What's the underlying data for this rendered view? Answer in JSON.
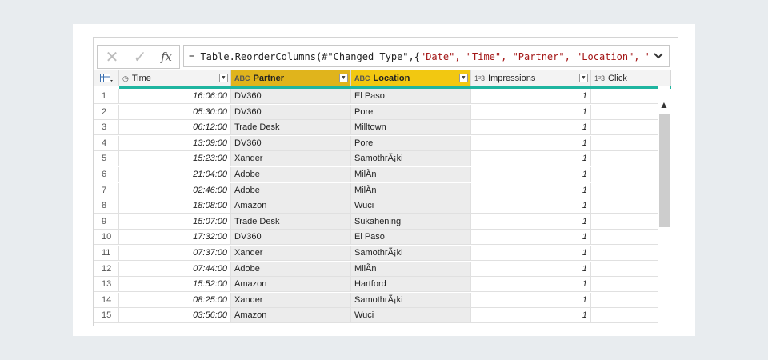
{
  "formula_bar": {
    "cancel_icon": "close-icon",
    "commit_icon": "check-icon",
    "fx_label": "fx",
    "formula_prefix": "= Table.ReorderColumns(#\"Changed Type\",{",
    "formula_strings": "\"Date\", \"Time\", \"Partner\", \"Location\", \"Impressions\",",
    "expand_icon": "chevron-down-icon"
  },
  "columns": [
    {
      "name": "Time",
      "type_icon": "clock-icon",
      "type_label": "◷"
    },
    {
      "name": "Partner",
      "type_icon": "text-type-icon",
      "type_label": "ABC"
    },
    {
      "name": "Location",
      "type_icon": "text-type-icon",
      "type_label": "ABC"
    },
    {
      "name": "Impressions",
      "type_icon": "number-type-icon",
      "type_label": "1²3"
    },
    {
      "name": "Click",
      "type_icon": "number-type-icon",
      "type_label": "1²3"
    }
  ],
  "rows": [
    {
      "n": "1",
      "time": "16:06:00",
      "partner": "DV360",
      "location": "El Paso",
      "impressions": "1"
    },
    {
      "n": "2",
      "time": "05:30:00",
      "partner": "DV360",
      "location": "Pore",
      "impressions": "1"
    },
    {
      "n": "3",
      "time": "06:12:00",
      "partner": "Trade Desk",
      "location": "Milltown",
      "impressions": "1"
    },
    {
      "n": "4",
      "time": "13:09:00",
      "partner": "DV360",
      "location": "Pore",
      "impressions": "1"
    },
    {
      "n": "5",
      "time": "15:23:00",
      "partner": "Xander",
      "location": "SamothrÃ¡ki",
      "impressions": "1"
    },
    {
      "n": "6",
      "time": "21:04:00",
      "partner": "Adobe",
      "location": "MilÃ­n",
      "impressions": "1"
    },
    {
      "n": "7",
      "time": "02:46:00",
      "partner": "Adobe",
      "location": "MilÃ­n",
      "impressions": "1"
    },
    {
      "n": "8",
      "time": "18:08:00",
      "partner": "Amazon",
      "location": "Wuci",
      "impressions": "1"
    },
    {
      "n": "9",
      "time": "15:07:00",
      "partner": "Trade Desk",
      "location": "Sukahening",
      "impressions": "1"
    },
    {
      "n": "10",
      "time": "17:32:00",
      "partner": "DV360",
      "location": "El Paso",
      "impressions": "1"
    },
    {
      "n": "11",
      "time": "07:37:00",
      "partner": "Xander",
      "location": "SamothrÃ¡ki",
      "impressions": "1"
    },
    {
      "n": "12",
      "time": "07:44:00",
      "partner": "Adobe",
      "location": "MilÃ­n",
      "impressions": "1"
    },
    {
      "n": "13",
      "time": "15:52:00",
      "partner": "Amazon",
      "location": "Hartford",
      "impressions": "1"
    },
    {
      "n": "14",
      "time": "08:25:00",
      "partner": "Xander",
      "location": "SamothrÃ¡ki",
      "impressions": "1"
    },
    {
      "n": "15",
      "time": "03:56:00",
      "partner": "Amazon",
      "location": "Wuci",
      "impressions": "1"
    }
  ],
  "colors": {
    "selected_header": "#e0b41c",
    "selected_header_2": "#f2c811",
    "column_quality": "#1fb5a0"
  }
}
